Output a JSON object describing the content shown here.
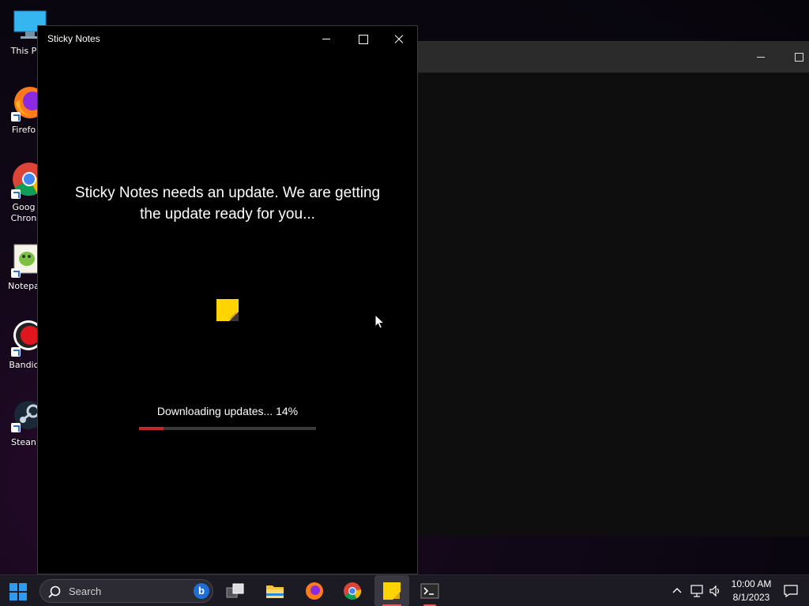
{
  "desktop": {
    "icons": [
      {
        "label": "This P",
        "icon": "computer-icon"
      },
      {
        "label": "Firefo",
        "icon": "firefox-icon"
      },
      {
        "label": "Goog\nChron",
        "icon": "chrome-icon"
      },
      {
        "label": "Notepa",
        "icon": "notepad-plus-plus-icon"
      },
      {
        "label": "Bandic",
        "icon": "bandicam-icon"
      },
      {
        "label": "Stean",
        "icon": "steam-icon"
      }
    ]
  },
  "sticky_notes": {
    "title": "Sticky Notes",
    "message": "Sticky Notes needs an update. We are getting the update ready for you...",
    "progress_text": "Downloading updates... 14%",
    "progress": 0.14,
    "accent": "#c4282b",
    "note_color": "#ffd400"
  },
  "taskbar": {
    "search_placeholder": "Search",
    "apps": [
      "task-view-icon",
      "file-explorer-icon",
      "firefox-icon",
      "chrome-icon",
      "sticky-notes-icon",
      "terminal-icon"
    ],
    "time": "10:00 AM",
    "date": "8/1/2023"
  }
}
